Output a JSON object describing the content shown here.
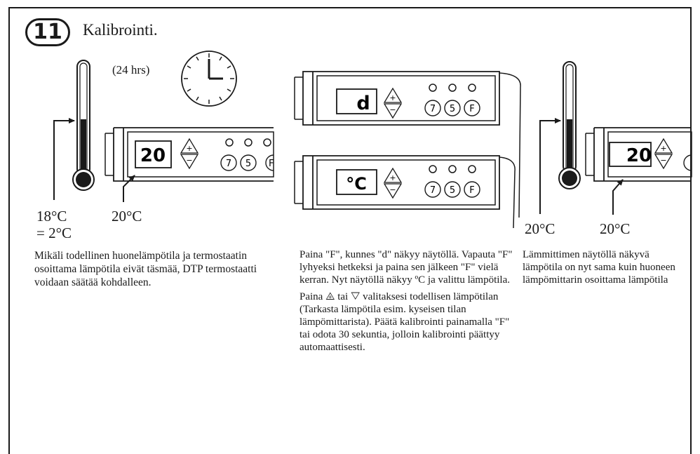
{
  "step": {
    "number": "11",
    "title": "Kalibrointi."
  },
  "clock": {
    "label": "(24 hrs)"
  },
  "panel_left": {
    "display": "20",
    "plus": "+",
    "minus": "−",
    "btn_7": "7",
    "btn_5": "5",
    "btn_f": "F"
  },
  "panel_mid_top": {
    "display": "d",
    "plus": "+",
    "minus": "−",
    "btn_7": "7",
    "btn_5": "5",
    "btn_f": "F"
  },
  "panel_mid_bottom": {
    "display": "°C",
    "plus": "+",
    "minus": "−",
    "btn_7": "7",
    "btn_5": "5",
    "btn_f": "F"
  },
  "panel_right": {
    "display": "20",
    "plus": "+",
    "minus": "−"
  },
  "labels": {
    "thermo_left": "18°C",
    "thermo_left_diff": "= 2°C",
    "display_left": "20°C",
    "thermo_right": "20°C",
    "display_right": "20°C"
  },
  "text": {
    "left": "Mikäli todellinen huonelämpötila ja termostaatin osoittama lämpötila eivät täsmää, DTP termostaatti voidaan säätää kohdalleen.",
    "middle_1": "Paina \"F\", kunnes \"d\" näkyy näytöllä. Vapauta \"F\" lyhyeksi hetkeksi ja paina sen jälkeen \"F\" vielä kerran. Nyt näytöllä näkyy ºC ja valittu lämpötila.",
    "middle_2": "Paina ⨹ tai ▽ valitaksesi todellisen lämpötilan (Tarkasta lämpötila esim. kyseisen tilan lämpömittarista). Päätä kalibrointi painamalla \"F\" tai odota 30 sekuntia, jolloin kalibrointi päättyy automaattisesti.",
    "right": "Lämmittimen näytöllä näkyvä lämpötila on nyt sama kuin huoneen lämpömittarin osoittama lämpötila"
  }
}
